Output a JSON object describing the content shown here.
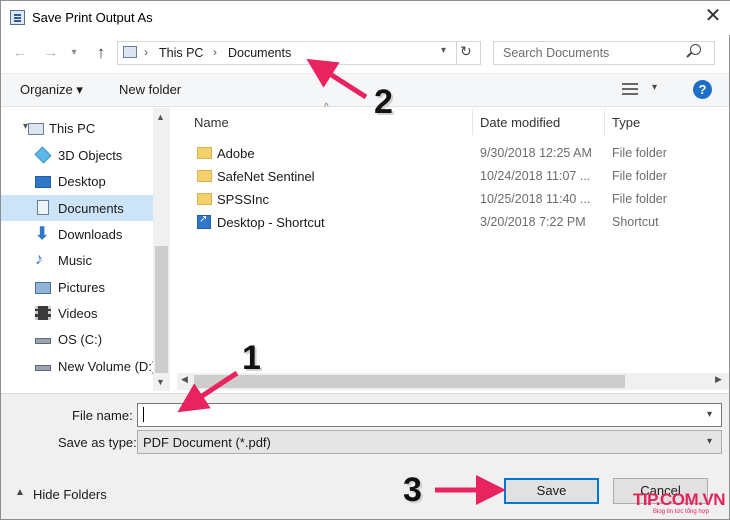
{
  "window": {
    "title": "Save Print Output As",
    "close_glyph": "✕"
  },
  "nav_buttons": {
    "back": "←",
    "forward": "→",
    "up": "↑",
    "refresh": "↻"
  },
  "address": {
    "crumbs": [
      "This PC",
      "Documents"
    ],
    "separator": "›"
  },
  "search": {
    "placeholder": "Search Documents"
  },
  "toolbar": {
    "organize": "Organize ▾",
    "new_folder": "New folder",
    "help": "?"
  },
  "nav_pane": {
    "items": [
      {
        "label": "This PC",
        "icon": "computer-icon",
        "selected": false
      },
      {
        "label": "3D Objects",
        "icon": "cube-icon",
        "selected": false
      },
      {
        "label": "Desktop",
        "icon": "desktop-icon",
        "selected": false
      },
      {
        "label": "Documents",
        "icon": "document-icon",
        "selected": true
      },
      {
        "label": "Downloads",
        "icon": "download-arrow-icon",
        "selected": false
      },
      {
        "label": "Music",
        "icon": "music-note-icon",
        "selected": false
      },
      {
        "label": "Pictures",
        "icon": "pictures-icon",
        "selected": false
      },
      {
        "label": "Videos",
        "icon": "film-icon",
        "selected": false
      },
      {
        "label": "OS (C:)",
        "icon": "drive-icon",
        "selected": false
      },
      {
        "label": "New Volume (D:)",
        "icon": "drive-icon",
        "selected": false
      }
    ]
  },
  "file_list": {
    "columns": [
      "Name",
      "Date modified",
      "Type"
    ],
    "rows": [
      {
        "name": "Adobe",
        "date": "9/30/2018 12:25 AM",
        "type": "File folder",
        "icon": "folder-icon"
      },
      {
        "name": "SafeNet Sentinel",
        "date": "10/24/2018 11:07 ...",
        "type": "File folder",
        "icon": "folder-icon"
      },
      {
        "name": "SPSSInc",
        "date": "10/25/2018 11:40 ...",
        "type": "File folder",
        "icon": "folder-icon"
      },
      {
        "name": "Desktop - Shortcut",
        "date": "3/20/2018 7:22 PM",
        "type": "Shortcut",
        "icon": "shortcut-icon"
      }
    ]
  },
  "form": {
    "file_name_label": "File name:",
    "file_name_value": "",
    "save_type_label": "Save as type:",
    "save_type_value": "PDF Document (*.pdf)"
  },
  "footer": {
    "hide_folders": "Hide Folders",
    "save": "Save",
    "cancel": "Cancel"
  },
  "annotations": {
    "one": "1",
    "two": "2",
    "three": "3",
    "accent": "#e8235f"
  },
  "watermark": {
    "brand": "TIP.COM.VN",
    "tagline": "Blog tin tức tổng hợp"
  }
}
